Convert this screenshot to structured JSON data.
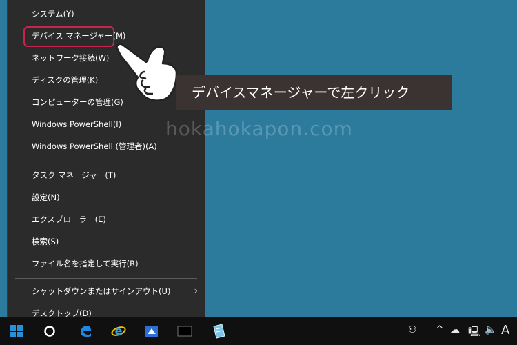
{
  "winx_menu": {
    "items": [
      {
        "label": "システム(Y)"
      },
      {
        "label": "デバイス マネージャー(M)"
      },
      {
        "label": "ネットワーク接続(W)"
      },
      {
        "label": "ディスクの管理(K)"
      },
      {
        "label": "コンピューターの管理(G)"
      },
      {
        "label": "Windows PowerShell(I)"
      },
      {
        "label": "Windows PowerShell (管理者)(A)"
      },
      {
        "label": "タスク マネージャー(T)"
      },
      {
        "label": "設定(N)"
      },
      {
        "label": "エクスプローラー(E)"
      },
      {
        "label": "検索(S)"
      },
      {
        "label": "ファイル名を指定して実行(R)"
      },
      {
        "label": "シャットダウンまたはサインアウト(U)"
      },
      {
        "label": "デスクトップ(D)"
      }
    ],
    "submenu_arrow": "›"
  },
  "callout": {
    "text": "デバイスマネージャーで左クリック"
  },
  "watermark": {
    "text": "hokahokapon.com"
  },
  "taskbar": {
    "icons": [
      "windows-start-icon",
      "cortana-circle-icon",
      "edge-icon",
      "ie-icon",
      "app-icon",
      "window-icon",
      "notepad-icon"
    ],
    "tray": {
      "people": "⚇",
      "chevron": "^",
      "onedrive": "☁",
      "network": "🖳",
      "volume": "🔈",
      "ime": "A"
    }
  },
  "colors": {
    "desktop": "#2c7a9c",
    "menu_bg": "#2b2b2b",
    "highlight_border": "#c8234e",
    "callout_bg": "#3b3232",
    "taskbar": "#101010"
  }
}
